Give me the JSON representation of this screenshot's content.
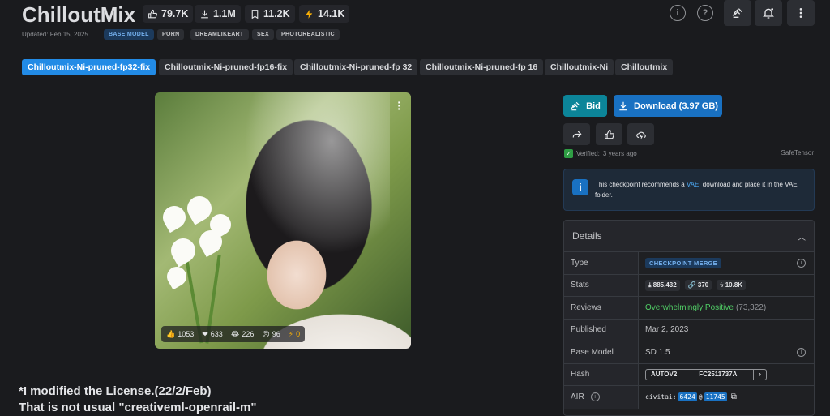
{
  "header": {
    "title": "ChilloutMix",
    "stats": {
      "likes": "79.7K",
      "downloads": "1.1M",
      "bookmarks": "11.2K",
      "buzz": "14.1K"
    },
    "updated": "Updated: Feb 15, 2025",
    "base_chip": "BASE MODEL",
    "tags": [
      "PORN",
      "DREAMLIKEART",
      "SEX",
      "PHOTOREALISTIC"
    ]
  },
  "version_tabs": [
    "Chilloutmix-Ni-pruned-fp32-fix",
    "Chilloutmix-Ni-pruned-fp16-fix",
    "Chilloutmix-Ni-pruned-fp 32",
    "Chilloutmix-Ni-pruned-fp 16",
    "Chilloutmix-Ni",
    "Chilloutmix"
  ],
  "reactions": {
    "like": "1053",
    "heart": "633",
    "laugh": "226",
    "cry": "96",
    "buzz": "0"
  },
  "license_text": [
    "*I modified the License.(22/2/Feb)",
    "That is not usual \"creativeml-openrail-m\""
  ],
  "actions": {
    "bid": "Bid",
    "download": "Download (3.97 GB)"
  },
  "verified": {
    "prefix": "Verified:",
    "when": "3 years ago",
    "safetensor": "SafeTensor"
  },
  "notice": {
    "before": "This checkpoint recommends a ",
    "link": "VAE",
    "after": ", download and place it in the VAE folder."
  },
  "details": {
    "heading": "Details",
    "type_label": "Type",
    "type_value": "CHECKPOINT MERGE",
    "stats_label": "Stats",
    "stat_downloads": "885,432",
    "stat_generations": "370",
    "stat_buzz": "10.8K",
    "reviews_label": "Reviews",
    "reviews_value": "Overwhelmingly Positive",
    "reviews_count": "(73,322)",
    "published_label": "Published",
    "published_value": "Mar 2, 2023",
    "base_label": "Base Model",
    "base_value": "SD 1.5",
    "hash_label": "Hash",
    "hash_type": "AUTOV2",
    "hash_value": "FC2511737A",
    "air_label": "AIR",
    "air_prefix": "civitai:",
    "air_model": "6424",
    "air_at": "@",
    "air_version": "11745"
  },
  "colors": {
    "accent": "#228be6",
    "bid": "#0c8599",
    "positive": "#51cf66"
  }
}
